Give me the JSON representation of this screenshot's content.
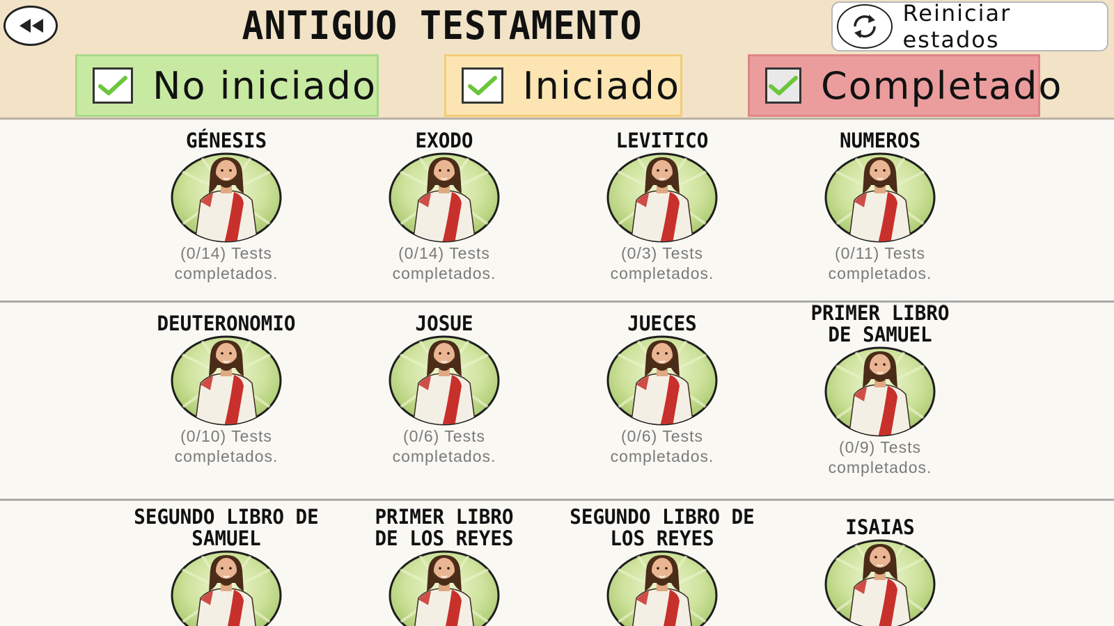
{
  "header": {
    "title": "ANTIGUO TESTAMENTO",
    "reset_label": "Reiniciar estados",
    "filters": [
      {
        "label": "No iniciado",
        "checked": true,
        "color": "#c8e9a2"
      },
      {
        "label": "Iniciado",
        "checked": true,
        "color": "#fce5b2"
      },
      {
        "label": "Completado",
        "checked": true,
        "color": "#eb9d9d"
      }
    ]
  },
  "books": [
    {
      "name": "GÉNESIS",
      "done": 0,
      "total": 14,
      "progress": "(0/14) Tests",
      "suffix": "completados."
    },
    {
      "name": "EXODO",
      "done": 0,
      "total": 14,
      "progress": "(0/14) Tests",
      "suffix": "completados."
    },
    {
      "name": "LEVITICO",
      "done": 0,
      "total": 3,
      "progress": "(0/3) Tests",
      "suffix": "completados."
    },
    {
      "name": "NUMEROS",
      "done": 0,
      "total": 11,
      "progress": "(0/11) Tests",
      "suffix": "completados."
    },
    {
      "name": "DEUTERONOMIO",
      "done": 0,
      "total": 10,
      "progress": "(0/10) Tests",
      "suffix": "completados."
    },
    {
      "name": "JOSUE",
      "done": 0,
      "total": 6,
      "progress": "(0/6) Tests",
      "suffix": "completados."
    },
    {
      "name": "JUECES",
      "done": 0,
      "total": 6,
      "progress": "(0/6) Tests",
      "suffix": "completados."
    },
    {
      "name": "PRIMER LIBRO DE SAMUEL",
      "done": 0,
      "total": 9,
      "progress": "(0/9) Tests",
      "suffix": "completados."
    },
    {
      "name": "SEGUNDO LIBRO DE SAMUEL"
    },
    {
      "name": "PRIMER LIBRO DE LOS REYES"
    },
    {
      "name": "SEGUNDO LIBRO DE LOS REYES"
    },
    {
      "name": "ISAIAS"
    }
  ],
  "icons": {
    "back": "rewind-icon",
    "reset": "refresh-icon",
    "check": "check-icon",
    "avatar": "jesus-avatar-icon"
  },
  "colors": {
    "header_bg": "#f2e3c7",
    "check_green": "#6cc63a",
    "robe_red": "#c8302c",
    "avatar_bg": "#c3dd8b"
  }
}
